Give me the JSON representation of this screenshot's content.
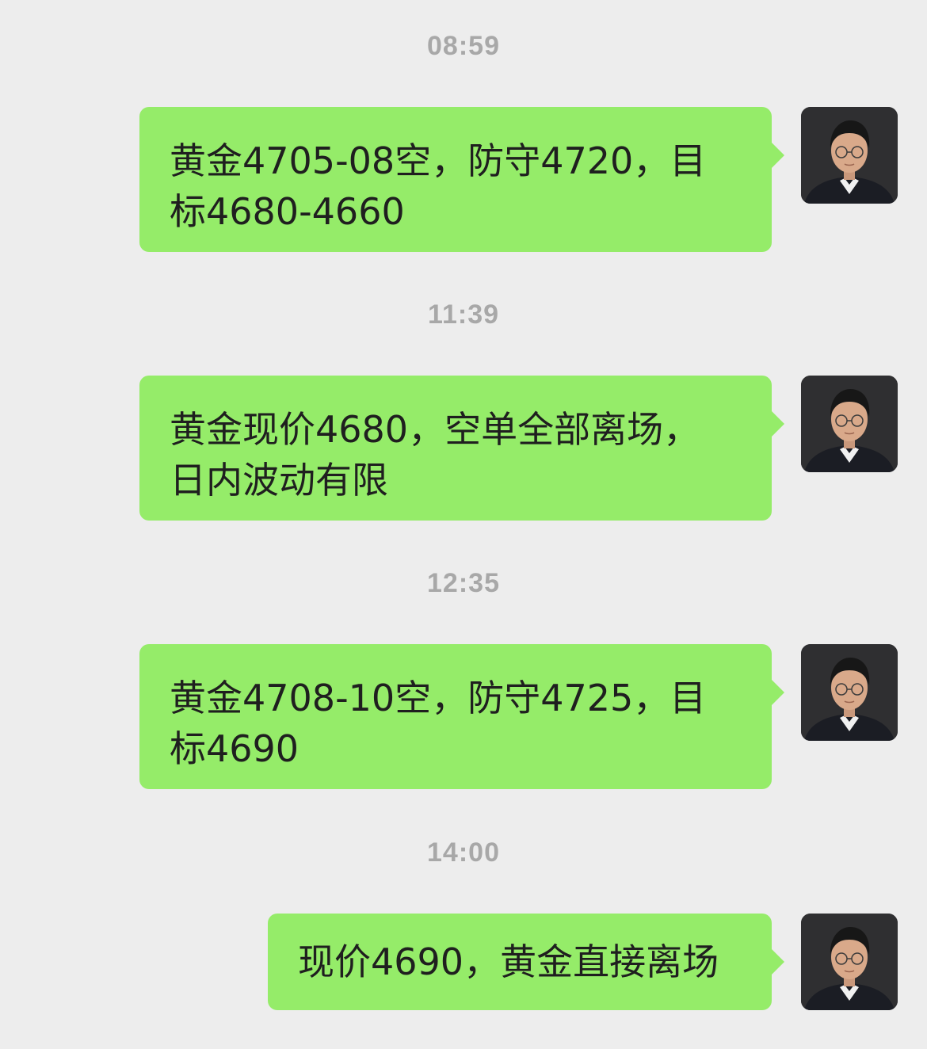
{
  "messages": [
    {
      "time": "08:59",
      "text": "黄金4705-08空，防守4720，目标4680-4660",
      "lines": [
        "黄金4705-08空，防守4720，目",
        "标4680-4660"
      ]
    },
    {
      "time": "11:39",
      "text": "黄金现价4680，空单全部离场，日内波动有限",
      "lines": [
        "黄金现价4680，空单全部离场，",
        "日内波动有限"
      ]
    },
    {
      "time": "12:35",
      "text": "黄金4708-10空，防守4725，目标4690",
      "lines": [
        "黄金4708-10空，防守4725，目",
        "标4690"
      ]
    },
    {
      "time": "14:00",
      "text": "现价4690，黄金直接离场",
      "lines": [
        "现价4690，黄金直接离场"
      ]
    }
  ],
  "colors": {
    "background": "#ededed",
    "bubble": "#95ec69",
    "timestamp": "#a8a8a8",
    "text": "#1f1f1f"
  },
  "icons": {
    "avatar": "user-avatar-photo"
  }
}
